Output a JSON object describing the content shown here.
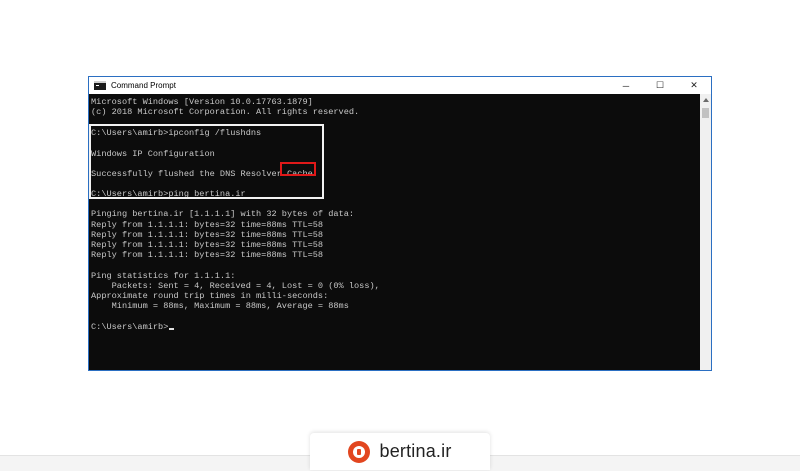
{
  "window": {
    "title": "Command Prompt",
    "controls": {
      "minimize": "─",
      "maximize": "☐",
      "close": "✕"
    }
  },
  "console": {
    "lines": [
      "Microsoft Windows [Version 10.0.17763.1879]",
      "(c) 2018 Microsoft Corporation. All rights reserved.",
      "",
      "C:\\Users\\amirb>ipconfig /flushdns",
      "",
      "Windows IP Configuration",
      "",
      "Successfully flushed the DNS Resolver Cache.",
      "C:\\Users\\amirb>ping bertina.ir",
      "",
      "Pinging bertina.ir [1.1.1.1] with 32 bytes of data:",
      "Reply from 1.1.1.1: bytes=32 time=88ms TTL=58",
      "Reply from 1.1.1.1: bytes=32 time=88ms TTL=58",
      "Reply from 1.1.1.1: bytes=32 time=88ms TTL=58",
      "Reply from 1.1.1.1: bytes=32 time=88ms TTL=58",
      "",
      "Ping statistics for 1.1.1.1:",
      "    Packets: Sent = 4, Received = 4, Lost = 0 (0% loss),",
      "Approximate round trip times in milli-seconds:",
      "    Minimum = 88ms, Maximum = 88ms, Average = 88ms",
      "",
      "C:\\Users\\amirb>"
    ]
  },
  "branding": {
    "name": "bertina.ir"
  },
  "colors": {
    "console_bg": "#0c0c0c",
    "console_text": "#c8c8c8",
    "highlight_box": "#f2f2f2",
    "highlight_red": "#e01919",
    "logo": "#e2461f"
  }
}
